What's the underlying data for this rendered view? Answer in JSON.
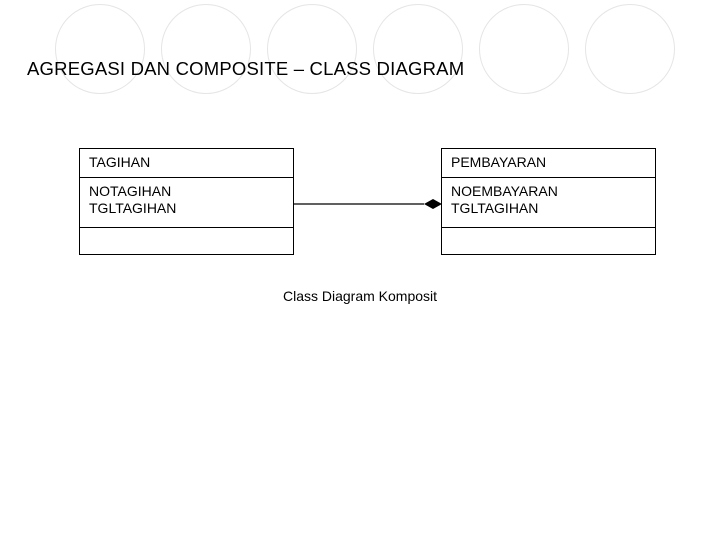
{
  "title": "AGREGASI DAN COMPOSITE – CLASS DIAGRAM",
  "caption": "Class Diagram Komposit",
  "classes": {
    "left": {
      "name": "TAGIHAN",
      "attr1": "NOTAGIHAN",
      "attr2": "TGLTAGIHAN"
    },
    "right": {
      "name": "PEMBAYARAN",
      "attr1": "NOEMBAYARAN",
      "attr2": "TGLTAGIHAN"
    }
  },
  "relationship": {
    "type": "composition",
    "diamond_fill": "#000000"
  }
}
